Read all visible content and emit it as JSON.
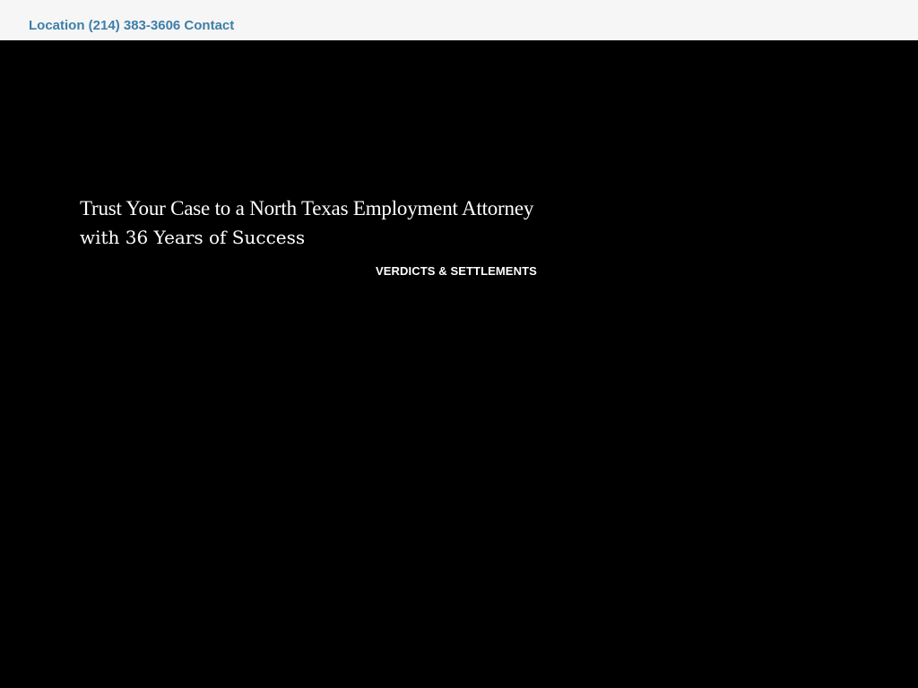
{
  "topbar": {
    "location_label": "Location",
    "phone_label": "(214) 383-3606",
    "contact_label": "Contact"
  },
  "hero": {
    "headline_line1": "Trust Your Case to a North Texas Employment Attorney",
    "headline_line2": "with 36 Years of Success",
    "verdicts_link_label": "VERDICTS & SETTLEMENTS"
  },
  "colors": {
    "topbar_background": "#f6f6f6",
    "link_accent": "#3d7fa8",
    "hero_background": "#000000",
    "hero_text": "#ffffff"
  }
}
